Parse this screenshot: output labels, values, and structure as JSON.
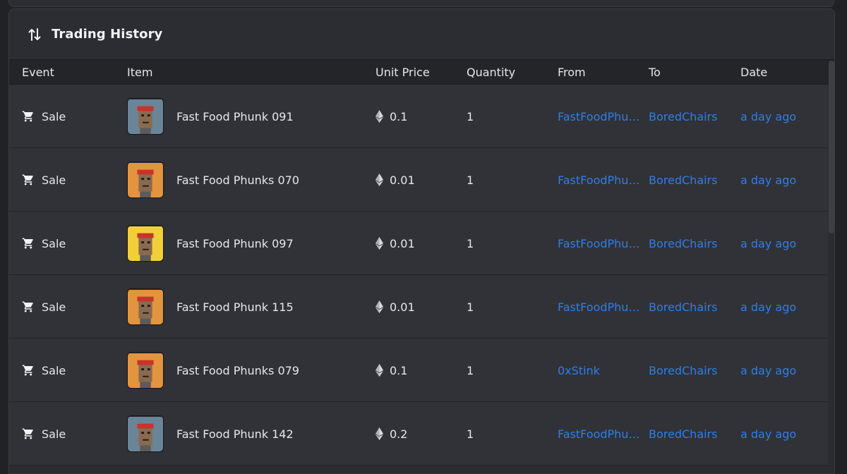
{
  "header": {
    "title": "Trading History"
  },
  "columns": {
    "event": "Event",
    "item": "Item",
    "unit_price": "Unit Price",
    "quantity": "Quantity",
    "from": "From",
    "to": "To",
    "date": "Date"
  },
  "rows": [
    {
      "event": "Sale",
      "item": "Fast Food Phunk 091",
      "price": "0.1",
      "quantity": "1",
      "from": "FastFoodPhunks",
      "to": "BoredChairs",
      "date": "a day ago",
      "thumb_bg": "#6a8597"
    },
    {
      "event": "Sale",
      "item": "Fast Food Phunks 070",
      "price": "0.01",
      "quantity": "1",
      "from": "FastFoodPhunks",
      "to": "BoredChairs",
      "date": "a day ago",
      "thumb_bg": "#e2943e"
    },
    {
      "event": "Sale",
      "item": "Fast Food Phunk 097",
      "price": "0.01",
      "quantity": "1",
      "from": "FastFoodPhunks",
      "to": "BoredChairs",
      "date": "a day ago",
      "thumb_bg": "#f2cf3a"
    },
    {
      "event": "Sale",
      "item": "Fast Food Phunk 115",
      "price": "0.01",
      "quantity": "1",
      "from": "FastFoodPhunks",
      "to": "BoredChairs",
      "date": "a day ago",
      "thumb_bg": "#e2943e"
    },
    {
      "event": "Sale",
      "item": "Fast Food Phunks 079",
      "price": "0.1",
      "quantity": "1",
      "from": "0xStink",
      "to": "BoredChairs",
      "date": "a day ago",
      "thumb_bg": "#e2943e"
    },
    {
      "event": "Sale",
      "item": "Fast Food Phunk 142",
      "price": "0.2",
      "quantity": "1",
      "from": "FastFoodPhunks",
      "to": "BoredChairs",
      "date": "a day ago",
      "thumb_bg": "#6a8597"
    }
  ],
  "colors": {
    "link": "#2f7ee8",
    "panel": "#2a2c31",
    "row": "#303237"
  },
  "icons": {
    "header": "swap-vertical-icon",
    "event": "cart-icon",
    "price": "ethereum-icon"
  }
}
